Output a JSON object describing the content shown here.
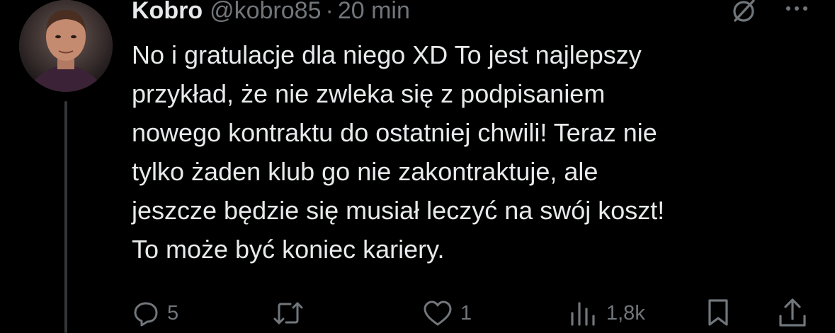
{
  "tweet": {
    "display_name": "Kobro",
    "handle": "@kobro85",
    "separator": "·",
    "time": "20 min",
    "text": "No i gratulacje dla niego XD To jest najlepszy\nprzykład, że nie zwleka się z podpisaniem\nnowego kontraktu do ostatniej chwili! Teraz nie\ntylko żaden klub go nie zakontraktuje, ale\njeszcze będzie się musiał leczyć na swój koszt!\nTo może być koniec kariery."
  },
  "actions": {
    "replies": "5",
    "reposts": "",
    "likes": "1",
    "views": "1,8k"
  },
  "icons": {
    "grok": "grok-icon",
    "more": "more-icon",
    "reply": "reply-icon",
    "repost": "repost-icon",
    "like": "like-icon",
    "views": "views-icon",
    "bookmark": "bookmark-icon",
    "share": "share-icon"
  },
  "colors": {
    "background": "#000000",
    "text": "#e7e9ea",
    "secondary": "#71767b",
    "thread_line": "#333639"
  }
}
